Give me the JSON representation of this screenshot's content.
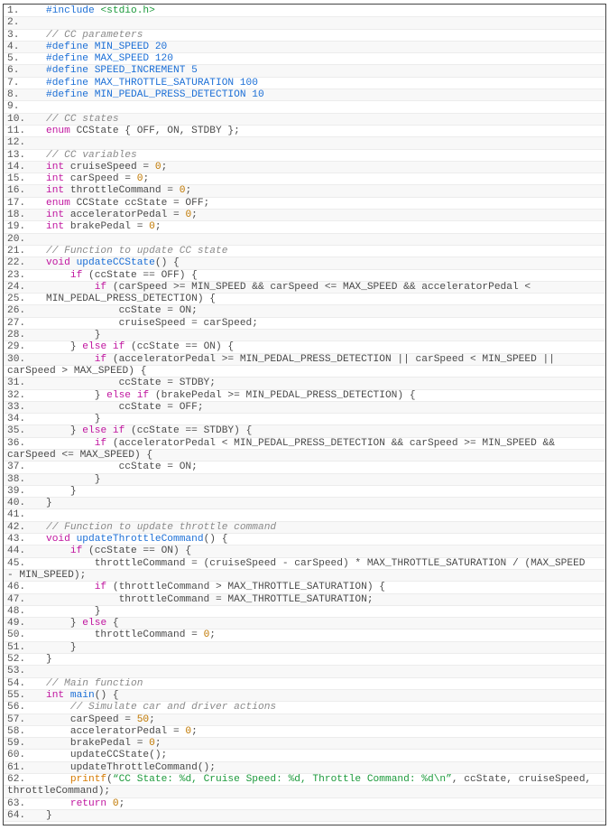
{
  "colors": {
    "keyword": "#c0159f",
    "preprocessor": "#1c6fd6",
    "number": "#c07800",
    "string": "#1d9a3c",
    "comment": "#8a8a8a",
    "text": "#4a4a4a"
  },
  "lines": [
    {
      "n": "1.",
      "t": [
        [
          "p",
          "#include "
        ],
        [
          "s",
          "<stdio.h>"
        ]
      ]
    },
    {
      "n": "2.",
      "t": []
    },
    {
      "n": "3.",
      "t": [
        [
          "c",
          "// CC parameters"
        ]
      ]
    },
    {
      "n": "4.",
      "t": [
        [
          "p",
          "#define MIN_SPEED 20"
        ]
      ]
    },
    {
      "n": "5.",
      "t": [
        [
          "p",
          "#define MAX_SPEED 120"
        ]
      ]
    },
    {
      "n": "6.",
      "t": [
        [
          "p",
          "#define SPEED_INCREMENT 5"
        ]
      ]
    },
    {
      "n": "7.",
      "t": [
        [
          "p",
          "#define MAX_THROTTLE_SATURATION 100"
        ]
      ]
    },
    {
      "n": "8.",
      "t": [
        [
          "p",
          "#define MIN_PEDAL_PRESS_DETECTION 10"
        ]
      ]
    },
    {
      "n": "9.",
      "t": []
    },
    {
      "n": "10.",
      "t": [
        [
          "c",
          "// CC states"
        ]
      ]
    },
    {
      "n": "11.",
      "t": [
        [
          "k",
          "enum"
        ],
        [
          "t",
          " CCState { OFF, ON, STDBY };"
        ]
      ]
    },
    {
      "n": "12.",
      "t": []
    },
    {
      "n": "13.",
      "t": [
        [
          "c",
          "// CC variables"
        ]
      ]
    },
    {
      "n": "14.",
      "t": [
        [
          "k",
          "int"
        ],
        [
          "t",
          " cruiseSpeed = "
        ],
        [
          "n",
          "0"
        ],
        [
          "t",
          ";"
        ]
      ]
    },
    {
      "n": "15.",
      "t": [
        [
          "k",
          "int"
        ],
        [
          "t",
          " carSpeed = "
        ],
        [
          "n",
          "0"
        ],
        [
          "t",
          ";"
        ]
      ]
    },
    {
      "n": "16.",
      "t": [
        [
          "k",
          "int"
        ],
        [
          "t",
          " throttleCommand = "
        ],
        [
          "n",
          "0"
        ],
        [
          "t",
          ";"
        ]
      ]
    },
    {
      "n": "17.",
      "t": [
        [
          "k",
          "enum"
        ],
        [
          "t",
          " CCState ccState = OFF;"
        ]
      ]
    },
    {
      "n": "18.",
      "t": [
        [
          "k",
          "int"
        ],
        [
          "t",
          " acceleratorPedal = "
        ],
        [
          "n",
          "0"
        ],
        [
          "t",
          ";"
        ]
      ]
    },
    {
      "n": "19.",
      "t": [
        [
          "k",
          "int"
        ],
        [
          "t",
          " brakePedal = "
        ],
        [
          "n",
          "0"
        ],
        [
          "t",
          ";"
        ]
      ]
    },
    {
      "n": "20.",
      "t": []
    },
    {
      "n": "21.",
      "t": [
        [
          "c",
          "// Function to update CC state"
        ]
      ]
    },
    {
      "n": "22.",
      "t": [
        [
          "k",
          "void"
        ],
        [
          "t",
          " "
        ],
        [
          "f",
          "updateCCState"
        ],
        [
          "t",
          "() {"
        ]
      ]
    },
    {
      "n": "23.",
      "t": [
        [
          "t",
          "    "
        ],
        [
          "k",
          "if"
        ],
        [
          "t",
          " (ccState == OFF) {"
        ]
      ]
    },
    {
      "n": "24.",
      "t": [
        [
          "t",
          "        "
        ],
        [
          "k",
          "if"
        ],
        [
          "t",
          " (carSpeed >= MIN_SPEED && carSpeed <= MAX_SPEED && acceleratorPedal <"
        ]
      ]
    },
    {
      "n": "25.",
      "t": [
        [
          "t",
          "MIN_PEDAL_PRESS_DETECTION) {"
        ]
      ]
    },
    {
      "n": "26.",
      "t": [
        [
          "t",
          "            ccState = ON;"
        ]
      ]
    },
    {
      "n": "27.",
      "t": [
        [
          "t",
          "            cruiseSpeed = carSpeed;"
        ]
      ]
    },
    {
      "n": "28.",
      "t": [
        [
          "t",
          "        }"
        ]
      ]
    },
    {
      "n": "29.",
      "t": [
        [
          "t",
          "    } "
        ],
        [
          "k",
          "else if"
        ],
        [
          "t",
          " (ccState == ON) {"
        ]
      ]
    },
    {
      "n": "30.",
      "t": [
        [
          "t",
          "        "
        ],
        [
          "k",
          "if"
        ],
        [
          "t",
          " (acceleratorPedal >= MIN_PEDAL_PRESS_DETECTION || carSpeed < MIN_SPEED ||"
        ]
      ],
      "cont": "carSpeed > MAX_SPEED) {"
    },
    {
      "n": "31.",
      "t": [
        [
          "t",
          "            ccState = STDBY;"
        ]
      ]
    },
    {
      "n": "32.",
      "t": [
        [
          "t",
          "        } "
        ],
        [
          "k",
          "else if"
        ],
        [
          "t",
          " (brakePedal >= MIN_PEDAL_PRESS_DETECTION) {"
        ]
      ]
    },
    {
      "n": "33.",
      "t": [
        [
          "t",
          "            ccState = OFF;"
        ]
      ]
    },
    {
      "n": "34.",
      "t": [
        [
          "t",
          "        }"
        ]
      ]
    },
    {
      "n": "35.",
      "t": [
        [
          "t",
          "    } "
        ],
        [
          "k",
          "else if"
        ],
        [
          "t",
          " (ccState == STDBY) {"
        ]
      ]
    },
    {
      "n": "36.",
      "t": [
        [
          "t",
          "        "
        ],
        [
          "k",
          "if"
        ],
        [
          "t",
          " (acceleratorPedal < MIN_PEDAL_PRESS_DETECTION && carSpeed >= MIN_SPEED &&"
        ]
      ],
      "cont": "carSpeed <= MAX_SPEED) {"
    },
    {
      "n": "37.",
      "t": [
        [
          "t",
          "            ccState = ON;"
        ]
      ]
    },
    {
      "n": "38.",
      "t": [
        [
          "t",
          "        }"
        ]
      ]
    },
    {
      "n": "39.",
      "t": [
        [
          "t",
          "    }"
        ]
      ]
    },
    {
      "n": "40.",
      "t": [
        [
          "t",
          "}"
        ]
      ]
    },
    {
      "n": "41.",
      "t": []
    },
    {
      "n": "42.",
      "t": [
        [
          "c",
          "// Function to update throttle command"
        ]
      ]
    },
    {
      "n": "43.",
      "t": [
        [
          "k",
          "void"
        ],
        [
          "t",
          " "
        ],
        [
          "f",
          "updateThrottleCommand"
        ],
        [
          "t",
          "() {"
        ]
      ]
    },
    {
      "n": "44.",
      "t": [
        [
          "t",
          "    "
        ],
        [
          "k",
          "if"
        ],
        [
          "t",
          " (ccState == ON) {"
        ]
      ]
    },
    {
      "n": "45.",
      "t": [
        [
          "t",
          "        throttleCommand = (cruiseSpeed - carSpeed) * MAX_THROTTLE_SATURATION / (MAX_SPEED"
        ]
      ],
      "cont": "- MIN_SPEED);"
    },
    {
      "n": "46.",
      "t": [
        [
          "t",
          "        "
        ],
        [
          "k",
          "if"
        ],
        [
          "t",
          " (throttleCommand > MAX_THROTTLE_SATURATION) {"
        ]
      ]
    },
    {
      "n": "47.",
      "t": [
        [
          "t",
          "            throttleCommand = MAX_THROTTLE_SATURATION;"
        ]
      ]
    },
    {
      "n": "48.",
      "t": [
        [
          "t",
          "        }"
        ]
      ]
    },
    {
      "n": "49.",
      "t": [
        [
          "t",
          "    } "
        ],
        [
          "k",
          "else"
        ],
        [
          "t",
          " {"
        ]
      ]
    },
    {
      "n": "50.",
      "t": [
        [
          "t",
          "        throttleCommand = "
        ],
        [
          "n",
          "0"
        ],
        [
          "t",
          ";"
        ]
      ]
    },
    {
      "n": "51.",
      "t": [
        [
          "t",
          "    }"
        ]
      ]
    },
    {
      "n": "52.",
      "t": [
        [
          "t",
          "}"
        ]
      ]
    },
    {
      "n": "53.",
      "t": []
    },
    {
      "n": "54.",
      "t": [
        [
          "c",
          "// Main function"
        ]
      ]
    },
    {
      "n": "55.",
      "t": [
        [
          "k",
          "int"
        ],
        [
          "t",
          " "
        ],
        [
          "f",
          "main"
        ],
        [
          "t",
          "() {"
        ]
      ]
    },
    {
      "n": "56.",
      "t": [
        [
          "t",
          "    "
        ],
        [
          "c",
          "// Simulate car and driver actions"
        ]
      ]
    },
    {
      "n": "57.",
      "t": [
        [
          "t",
          "    carSpeed = "
        ],
        [
          "n",
          "50"
        ],
        [
          "t",
          ";"
        ]
      ]
    },
    {
      "n": "58.",
      "t": [
        [
          "t",
          "    acceleratorPedal = "
        ],
        [
          "n",
          "0"
        ],
        [
          "t",
          ";"
        ]
      ]
    },
    {
      "n": "59.",
      "t": [
        [
          "t",
          "    brakePedal = "
        ],
        [
          "n",
          "0"
        ],
        [
          "t",
          ";"
        ]
      ]
    },
    {
      "n": "60.",
      "t": [
        [
          "t",
          "    updateCCState();"
        ]
      ]
    },
    {
      "n": "61.",
      "t": [
        [
          "t",
          "    updateThrottleCommand();"
        ]
      ]
    },
    {
      "n": "62.",
      "t": [
        [
          "t",
          "    "
        ],
        [
          "o",
          "printf"
        ],
        [
          "t",
          "("
        ],
        [
          "s",
          "“CC State: %d, Cruise Speed: %d, Throttle Command: %d\\n”"
        ],
        [
          "t",
          ", ccState, cruiseSpeed,"
        ]
      ],
      "cont": "throttleCommand);"
    },
    {
      "n": "63.",
      "t": [
        [
          "t",
          "    "
        ],
        [
          "k",
          "return"
        ],
        [
          "t",
          " "
        ],
        [
          "n",
          "0"
        ],
        [
          "t",
          ";"
        ]
      ]
    },
    {
      "n": "64.",
      "t": [
        [
          "t",
          "}"
        ]
      ]
    }
  ]
}
